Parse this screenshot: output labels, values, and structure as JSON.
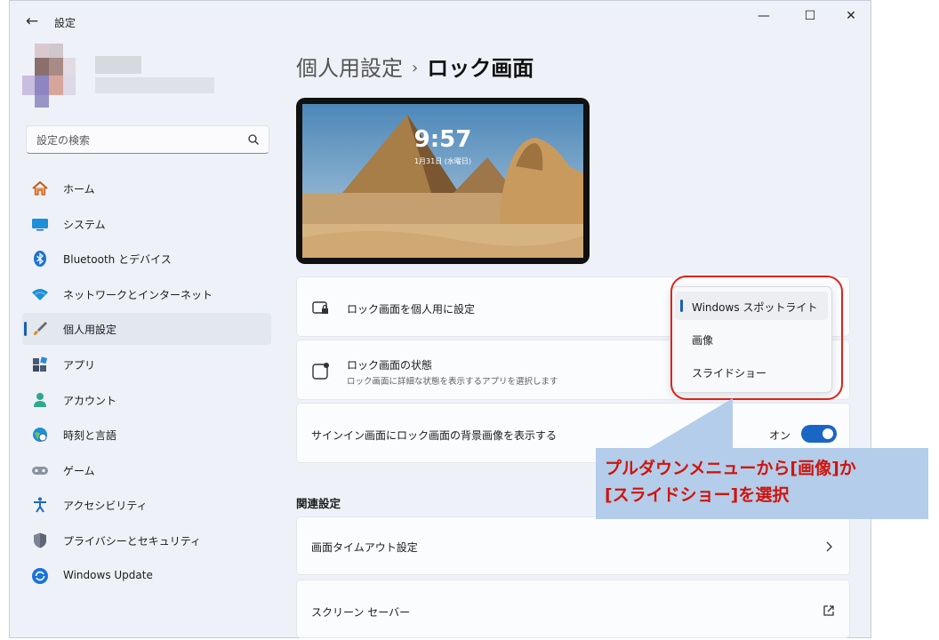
{
  "window": {
    "app_title": "設定",
    "back_glyph": "←",
    "controls": {
      "minimize": "—",
      "maximize": "☐",
      "close": "✕"
    }
  },
  "search": {
    "placeholder": "設定の検索"
  },
  "sidebar": {
    "items": [
      {
        "label": "ホーム",
        "icon": "home-icon"
      },
      {
        "label": "システム",
        "icon": "system-icon"
      },
      {
        "label": "Bluetooth とデバイス",
        "icon": "bluetooth-icon"
      },
      {
        "label": "ネットワークとインターネット",
        "icon": "wifi-icon"
      },
      {
        "label": "個人用設定",
        "icon": "brush-icon",
        "active": true
      },
      {
        "label": "アプリ",
        "icon": "apps-icon"
      },
      {
        "label": "アカウント",
        "icon": "account-icon"
      },
      {
        "label": "時刻と言語",
        "icon": "globe-clock-icon"
      },
      {
        "label": "ゲーム",
        "icon": "gamepad-icon"
      },
      {
        "label": "アクセシビリティ",
        "icon": "accessibility-icon"
      },
      {
        "label": "プライバシーとセキュリティ",
        "icon": "shield-icon"
      },
      {
        "label": "Windows Update",
        "icon": "update-icon"
      }
    ]
  },
  "breadcrumb": {
    "parent": "個人用設定",
    "separator": "›",
    "current": "ロック画面"
  },
  "preview": {
    "time": "9:57",
    "date": "1月31日 (水曜日)"
  },
  "settings": {
    "personalize": {
      "label": "ロック画面を個人用に設定"
    },
    "status": {
      "label": "ロック画面の状態",
      "description": "ロック画面に詳細な状態を表示するアプリを選択します"
    },
    "signin_background": {
      "label": "サインイン画面にロック画面の背景画像を表示する",
      "state": "オン",
      "on": true
    }
  },
  "dropdown": {
    "options": [
      "Windows スポットライト",
      "画像",
      "スライドショー"
    ],
    "selected": "Windows スポットライト"
  },
  "related": {
    "title": "関連設定",
    "items": [
      {
        "label": "画面タイムアウト設定",
        "icon": "chevron-right-icon"
      },
      {
        "label": "スクリーン セーバー",
        "icon": "open-external-icon"
      }
    ]
  },
  "annotation": {
    "line1": "プルダウンメニューから[画像]か",
    "line2": "[スライドショー]を選択"
  },
  "colors": {
    "accent": "#1a66c4",
    "annotation_red": "#e0221a",
    "callout_bg": "#b3cdea"
  }
}
